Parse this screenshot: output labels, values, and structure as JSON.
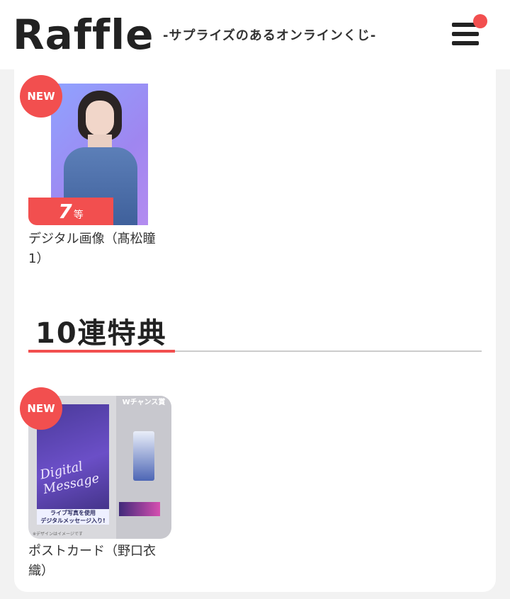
{
  "header": {
    "logo": "Raffle",
    "tagline": "-サプライズのあるオンラインくじ-"
  },
  "items": [
    {
      "badge": "NEW",
      "rank_num": "7",
      "rank_unit": "等",
      "name": "デジタル画像（髙松瞳 1）"
    }
  ],
  "section": {
    "title": "10連特典"
  },
  "bonus_items": [
    {
      "badge": "NEW",
      "thumb_tag": "Wチャンス賞",
      "thumb_title": "Digital Message",
      "thumb_caption": "ライブ写真を使用\nデジタルメッセージ入り!",
      "thumb_note": "※デザインはイメージです",
      "name": "ポストカード（野口衣織）"
    }
  ],
  "colors": {
    "accent": "#f24f4f",
    "background": "#f2f2f2",
    "card": "#ffffff",
    "text": "#333333"
  },
  "icons": [
    "hamburger-menu-icon",
    "notification-dot-icon"
  ]
}
